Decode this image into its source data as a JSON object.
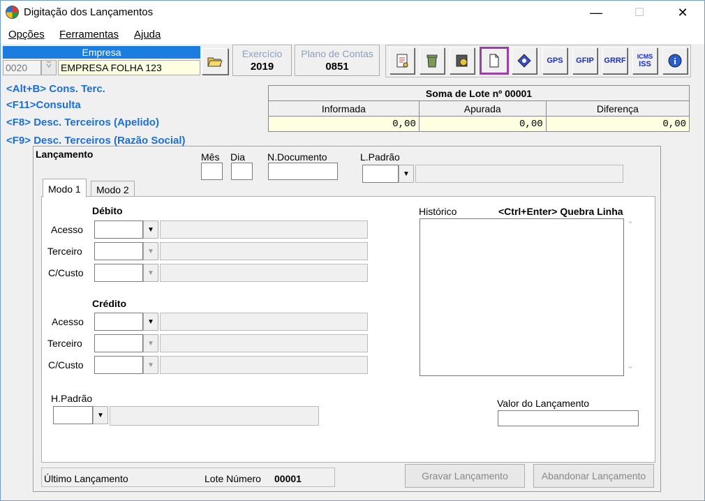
{
  "window": {
    "title": "Digitação dos Lançamentos",
    "minimize": "—",
    "maximize": "☐",
    "close": "✕"
  },
  "menu": {
    "opcoes": "Opções",
    "ferramentas": "Ferramentas",
    "ajuda": "Ajuda"
  },
  "empresa": {
    "header": "Empresa",
    "code": "0020",
    "name": "EMPRESA FOLHA 123"
  },
  "exercicio": {
    "label": "Exercício",
    "value": "2019"
  },
  "plano": {
    "label": "Plano de Contas",
    "value": "0851"
  },
  "toolbar": {
    "gps": "GPS",
    "gfip": "GFIP",
    "grrf": "GRRF",
    "icms_iss_1": "ICMS",
    "icms_iss_2": "ISS",
    "info": "i"
  },
  "shortcuts": {
    "cons_terc": "<Alt+B> Cons. Terc.",
    "consulta": "<F11>Consulta",
    "desc_apelido": "<F8> Desc. Terceiros (Apelido)",
    "desc_razao": "<F9> Desc. Terceiros (Razão Social)"
  },
  "soma": {
    "title": "Soma de Lote nº 00001",
    "headers": [
      "Informada",
      "Apurada",
      "Diferença"
    ],
    "values": [
      "0,00",
      "0,00",
      "0,00"
    ]
  },
  "lancamento": {
    "title": "Lançamento",
    "mes": "Mês",
    "dia": "Dia",
    "ndoc": "N.Documento",
    "lpadrao": "L.Padrão"
  },
  "tabs": {
    "modo1": "Modo 1",
    "modo2": "Modo 2"
  },
  "debito": {
    "title": "Débito",
    "acesso": "Acesso",
    "terceiro": "Terceiro",
    "ccusto": "C/Custo"
  },
  "credito": {
    "title": "Crédito",
    "acesso": "Acesso",
    "terceiro": "Terceiro",
    "ccusto": "C/Custo"
  },
  "historico": {
    "label": "Histórico",
    "hint": "<Ctrl+Enter> Quebra Linha"
  },
  "hpadrao": "H.Padrão",
  "valor_label": "Valor do Lançamento",
  "footer": {
    "ultimo": "Último Lançamento",
    "lote_label": "Lote Número",
    "lote_value": "00001",
    "gravar": "Gravar Lançamento",
    "abandonar": "Abandonar Lançamento"
  }
}
